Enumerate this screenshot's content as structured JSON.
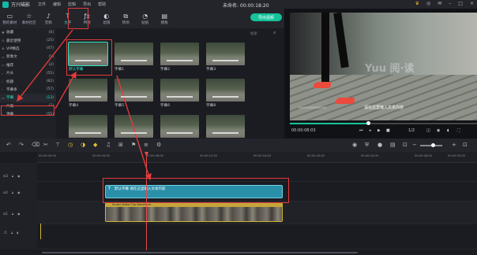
{
  "app": {
    "name": "万兴喵影",
    "menu": [
      "文件",
      "编辑",
      "剪辑",
      "导出",
      "帮助"
    ],
    "project_title": "未命名: 00:00:18:20"
  },
  "tabs": [
    {
      "label": "我的素材",
      "icon": "folder-icon"
    },
    {
      "label": "素材社区",
      "icon": "star-icon"
    },
    {
      "label": "音频",
      "icon": "music-icon"
    },
    {
      "label": "文字",
      "icon": "text-icon",
      "active": true
    },
    {
      "label": "特效",
      "icon": "fx-icon"
    },
    {
      "label": "滤镜",
      "icon": "filter-icon"
    },
    {
      "label": "转场",
      "icon": "transition-icon"
    },
    {
      "label": "贴纸",
      "icon": "sticker-icon"
    },
    {
      "label": "模板",
      "icon": "template-icon"
    }
  ],
  "export_label": "导出视频",
  "sidebar": [
    {
      "label": "收藏",
      "count": "(0)"
    },
    {
      "label": "最近使用",
      "count": "(25)"
    },
    {
      "label": "VIP精选",
      "count": "(47)"
    },
    {
      "label": "新春文",
      "count": "(1)"
    },
    {
      "label": "推荐",
      "count": "(2)"
    },
    {
      "label": "片头",
      "count": "(55)"
    },
    {
      "label": "标题",
      "count": "(82)"
    },
    {
      "label": "字幕条",
      "count": "(57)"
    },
    {
      "label": "字幕",
      "count": "(13)",
      "active": true
    },
    {
      "label": "片尾",
      "count": "(2)"
    },
    {
      "label": "弹幕",
      "count": "(55)"
    }
  ],
  "library": {
    "search_placeholder": "搜索",
    "items": [
      "默认字幕",
      "字幕1",
      "字幕2",
      "字幕3",
      "字幕4",
      "字幕5",
      "字幕6",
      "字幕8",
      "",
      "",
      "",
      ""
    ]
  },
  "preview": {
    "watermark": "Yuu 阅·读",
    "subtitle": "请在这里输入文本内容",
    "corner_text": "XNM2XN5MNX0Y42",
    "time_current": "00:00:08:03",
    "page": "1/2",
    "progress": 0.42
  },
  "timeline": {
    "ruler": [
      "00:00:00:00",
      "00:00:04:00",
      "00:00:08:00",
      "00:00:12:00",
      "00:00:16:00",
      "00:00:20:00",
      "00:00:24:00",
      "00:00:28:00",
      "00:00:32:00"
    ],
    "text_clip_label": "默认字幕 请在这里输入文本内容",
    "video_clip_label": "Smart Video Clip Waveform"
  },
  "colors": {
    "accent": "#2ee6c8",
    "export": "#16c29a",
    "annotation": "#e23b3b",
    "text_clip": "#2a8fa8",
    "video_border": "#d0b430"
  }
}
